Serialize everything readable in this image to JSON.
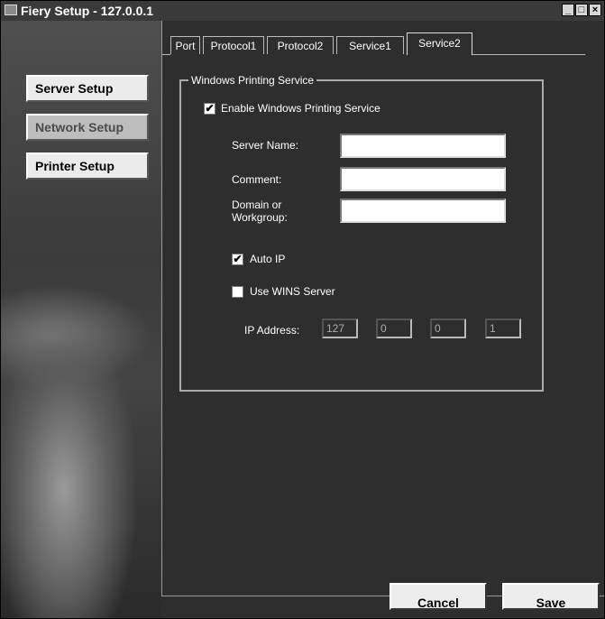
{
  "window": {
    "title": "Fiery Setup - 127.0.0.1",
    "controls": {
      "minimize": "_",
      "maximize": "□",
      "close": "×"
    }
  },
  "sidebar": {
    "items": [
      {
        "label": "Server Setup",
        "selected": false
      },
      {
        "label": "Network Setup",
        "selected": true
      },
      {
        "label": "Printer Setup",
        "selected": false
      }
    ]
  },
  "tabs": [
    {
      "label": "Port",
      "active": false
    },
    {
      "label": "Protocol1",
      "active": false
    },
    {
      "label": "Protocol2",
      "active": false
    },
    {
      "label": "Service1",
      "active": false
    },
    {
      "label": "Service2",
      "active": true
    }
  ],
  "group": {
    "legend": "Windows Printing Service",
    "enable_label": "Enable Windows Printing Service",
    "enable_checked": true,
    "server_name_label": "Server Name:",
    "server_name_value": "",
    "comment_label": "Comment:",
    "comment_value": "",
    "domain_label_1": "Domain or",
    "domain_label_2": "Workgroup:",
    "domain_value": "",
    "auto_ip_label": "Auto IP",
    "auto_ip_checked": true,
    "wins_label": "Use WINS Server",
    "wins_checked": false,
    "ip_label": "IP Address:",
    "ip": [
      "127",
      "0",
      "0",
      "1"
    ]
  },
  "buttons": {
    "cancel": "Cancel",
    "save": "Save"
  }
}
